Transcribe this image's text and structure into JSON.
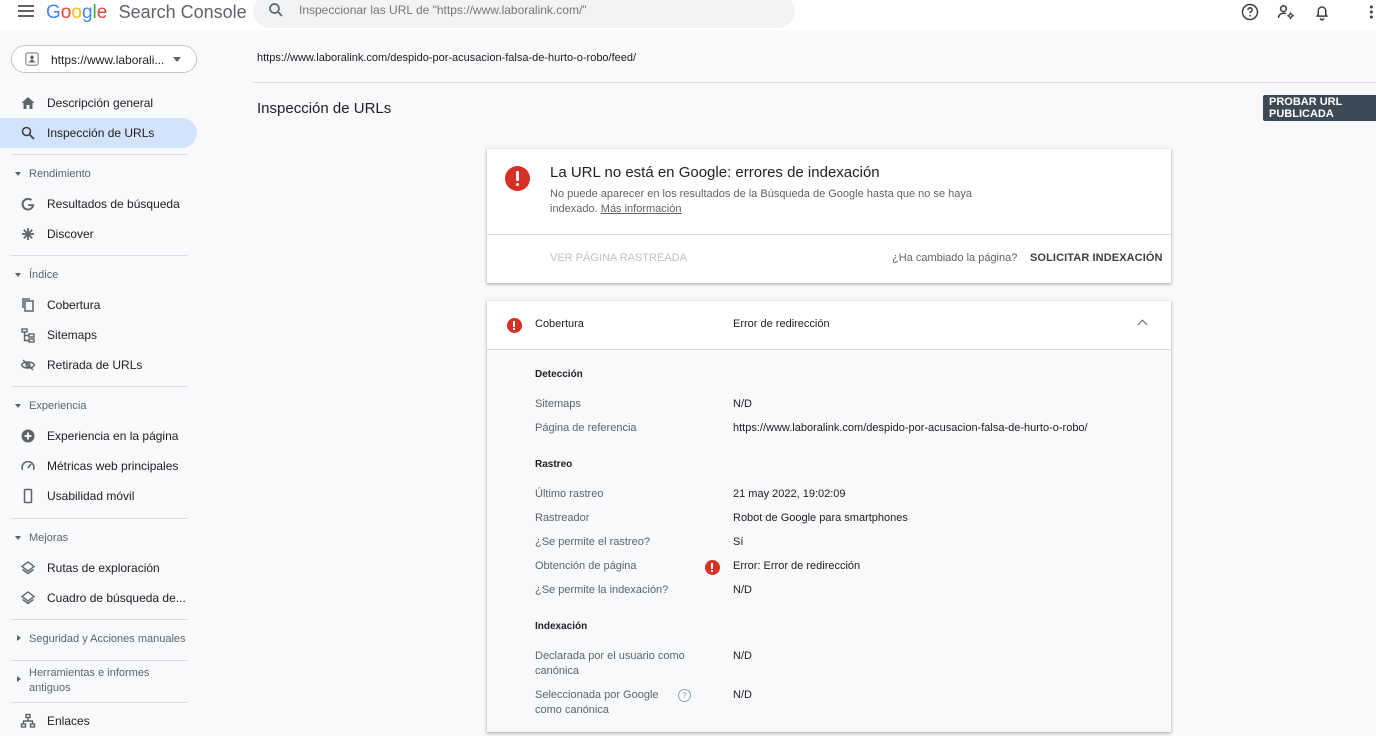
{
  "app": {
    "logo_letters": [
      "G",
      "o",
      "o",
      "g",
      "l",
      "e"
    ],
    "logo_colors": [
      "#4285f4",
      "#ea4335",
      "#fbbc05",
      "#4285f4",
      "#34a853",
      "#ea4335"
    ],
    "product_name": "Search Console"
  },
  "search": {
    "placeholder": "Inspeccionar las URL de \"https://www.laboralink.com/\""
  },
  "topbar_icons": [
    "help-icon",
    "manage-users-icon",
    "notifications-icon",
    "more-vert-icon"
  ],
  "property": {
    "label": "https://www.laborali..."
  },
  "sidebar": {
    "overview": "Descripción general",
    "url_inspection": "Inspección de URLs",
    "sections": {
      "performance": "Rendimiento",
      "index": "Índice",
      "experience": "Experiencia",
      "enhancements": "Mejoras",
      "security": "Seguridad y Acciones manuales",
      "legacy": "Herramientas e informes antiguos"
    },
    "items": {
      "search_results": "Resultados de búsqueda",
      "discover": "Discover",
      "coverage": "Cobertura",
      "sitemaps": "Sitemaps",
      "removals": "Retirada de URLs",
      "page_experience": "Experiencia en la página",
      "core_web_vitals": "Métricas web principales",
      "mobile_usability": "Usabilidad móvil",
      "breadcrumbs": "Rutas de exploración",
      "sitelinks_searchbox": "Cuadro de búsqueda de...",
      "links": "Enlaces"
    }
  },
  "main": {
    "inspected_url": "https://www.laboralink.com/despido-por-acusacion-falsa-de-hurto-o-robo/feed/",
    "title": "Inspección de URLs",
    "test_live_button": "PROBAR URL PUBLICADA"
  },
  "status": {
    "title": "La URL no está en Google: errores de indexación",
    "description": "No puede aparecer en los resultados de la Búsqueda de Google hasta que no se haya indexado.",
    "learn_more": "Más información",
    "view_crawled": "VER PÁGINA RASTREADA",
    "changed_question": "¿Ha cambiado la página?",
    "request_indexing": "SOLICITAR INDEXACIÓN",
    "error_color": "#d93025"
  },
  "coverage": {
    "name": "Cobertura",
    "status": "Error de redirección",
    "discovery": {
      "heading": "Detección",
      "sitemaps_label": "Sitemaps",
      "sitemaps_value": "N/D",
      "referring_label": "Página de referencia",
      "referring_value": "https://www.laboralink.com/despido-por-acusacion-falsa-de-hurto-o-robo/"
    },
    "crawl": {
      "heading": "Rastreo",
      "last_crawl_label": "Último rastreo",
      "last_crawl_value": "21 may 2022, 19:02:09",
      "crawler_label": "Rastreador",
      "crawler_value": "Robot de Google para smartphones",
      "crawl_allowed_label": "¿Se permite el rastreo?",
      "crawl_allowed_value": "Sí",
      "page_fetch_label": "Obtención de página",
      "page_fetch_value": "Error: Error de redirección",
      "indexing_allowed_label": "¿Se permite la indexación?",
      "indexing_allowed_value": "N/D"
    },
    "indexing": {
      "heading": "Indexación",
      "user_canonical_label": "Declarada por el usuario como canónica",
      "user_canonical_value": "N/D",
      "google_canonical_label": "Seleccionada por Google como canónica",
      "google_canonical_value": "N/D",
      "help_glyph": "?"
    }
  }
}
